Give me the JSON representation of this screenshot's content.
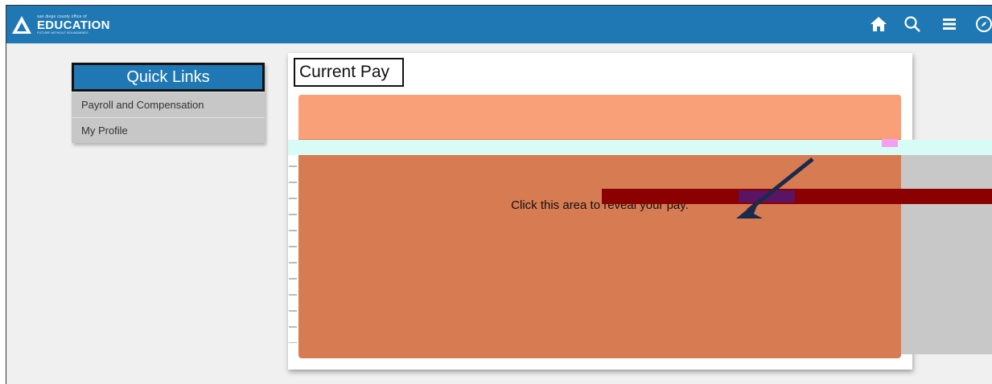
{
  "header": {
    "logo_small": "san diego county office of",
    "logo_big": "EDUCATION",
    "logo_tagline": "FUTURE WITHOUT BOUNDARIES",
    "bg_color": "#1f78b4",
    "icons": [
      "home-icon",
      "search-icon",
      "menu-icon",
      "compass-icon"
    ]
  },
  "quick_links": {
    "title": "Quick Links",
    "items": [
      {
        "label": "Payroll and Compensation"
      },
      {
        "label": "My Profile"
      }
    ]
  },
  "current_pay": {
    "title": "Current Pay",
    "reveal_text": "Click this area to reveal your pay.",
    "panel_color": "#d77b53",
    "panel_top_color": "#f9a078"
  }
}
